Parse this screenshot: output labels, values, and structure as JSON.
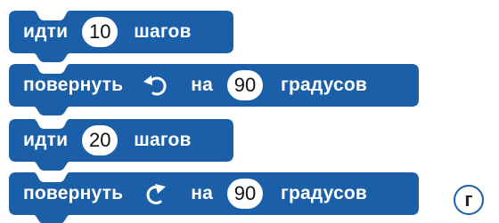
{
  "colors": {
    "block": "#1a5fa8",
    "text": "#ffffff",
    "slot": "#ffffff",
    "answer_border": "#1a5fa8"
  },
  "blocks": [
    {
      "word1": "идти",
      "value": "10",
      "word2": "шагов"
    },
    {
      "word1": "повернуть",
      "icon": "rotate-left-icon",
      "word_na": "на",
      "value": "90",
      "word2": "градусов"
    },
    {
      "word1": "идти",
      "value": "20",
      "word2": "шагов"
    },
    {
      "word1": "повернуть",
      "icon": "rotate-right-icon",
      "word_na": "на",
      "value": "90",
      "word2": "градусов"
    }
  ],
  "answer_label": "г"
}
